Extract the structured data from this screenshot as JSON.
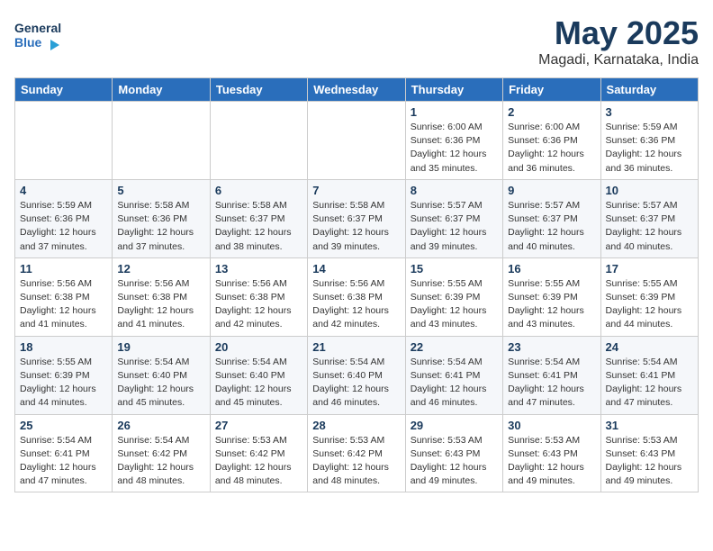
{
  "logo": {
    "line1": "General",
    "line2": "Blue"
  },
  "header": {
    "month_year": "May 2025",
    "location": "Magadi, Karnataka, India"
  },
  "weekdays": [
    "Sunday",
    "Monday",
    "Tuesday",
    "Wednesday",
    "Thursday",
    "Friday",
    "Saturday"
  ],
  "weeks": [
    [
      {
        "day": "",
        "detail": ""
      },
      {
        "day": "",
        "detail": ""
      },
      {
        "day": "",
        "detail": ""
      },
      {
        "day": "",
        "detail": ""
      },
      {
        "day": "1",
        "detail": "Sunrise: 6:00 AM\nSunset: 6:36 PM\nDaylight: 12 hours\nand 35 minutes."
      },
      {
        "day": "2",
        "detail": "Sunrise: 6:00 AM\nSunset: 6:36 PM\nDaylight: 12 hours\nand 36 minutes."
      },
      {
        "day": "3",
        "detail": "Sunrise: 5:59 AM\nSunset: 6:36 PM\nDaylight: 12 hours\nand 36 minutes."
      }
    ],
    [
      {
        "day": "4",
        "detail": "Sunrise: 5:59 AM\nSunset: 6:36 PM\nDaylight: 12 hours\nand 37 minutes."
      },
      {
        "day": "5",
        "detail": "Sunrise: 5:58 AM\nSunset: 6:36 PM\nDaylight: 12 hours\nand 37 minutes."
      },
      {
        "day": "6",
        "detail": "Sunrise: 5:58 AM\nSunset: 6:37 PM\nDaylight: 12 hours\nand 38 minutes."
      },
      {
        "day": "7",
        "detail": "Sunrise: 5:58 AM\nSunset: 6:37 PM\nDaylight: 12 hours\nand 39 minutes."
      },
      {
        "day": "8",
        "detail": "Sunrise: 5:57 AM\nSunset: 6:37 PM\nDaylight: 12 hours\nand 39 minutes."
      },
      {
        "day": "9",
        "detail": "Sunrise: 5:57 AM\nSunset: 6:37 PM\nDaylight: 12 hours\nand 40 minutes."
      },
      {
        "day": "10",
        "detail": "Sunrise: 5:57 AM\nSunset: 6:37 PM\nDaylight: 12 hours\nand 40 minutes."
      }
    ],
    [
      {
        "day": "11",
        "detail": "Sunrise: 5:56 AM\nSunset: 6:38 PM\nDaylight: 12 hours\nand 41 minutes."
      },
      {
        "day": "12",
        "detail": "Sunrise: 5:56 AM\nSunset: 6:38 PM\nDaylight: 12 hours\nand 41 minutes."
      },
      {
        "day": "13",
        "detail": "Sunrise: 5:56 AM\nSunset: 6:38 PM\nDaylight: 12 hours\nand 42 minutes."
      },
      {
        "day": "14",
        "detail": "Sunrise: 5:56 AM\nSunset: 6:38 PM\nDaylight: 12 hours\nand 42 minutes."
      },
      {
        "day": "15",
        "detail": "Sunrise: 5:55 AM\nSunset: 6:39 PM\nDaylight: 12 hours\nand 43 minutes."
      },
      {
        "day": "16",
        "detail": "Sunrise: 5:55 AM\nSunset: 6:39 PM\nDaylight: 12 hours\nand 43 minutes."
      },
      {
        "day": "17",
        "detail": "Sunrise: 5:55 AM\nSunset: 6:39 PM\nDaylight: 12 hours\nand 44 minutes."
      }
    ],
    [
      {
        "day": "18",
        "detail": "Sunrise: 5:55 AM\nSunset: 6:39 PM\nDaylight: 12 hours\nand 44 minutes."
      },
      {
        "day": "19",
        "detail": "Sunrise: 5:54 AM\nSunset: 6:40 PM\nDaylight: 12 hours\nand 45 minutes."
      },
      {
        "day": "20",
        "detail": "Sunrise: 5:54 AM\nSunset: 6:40 PM\nDaylight: 12 hours\nand 45 minutes."
      },
      {
        "day": "21",
        "detail": "Sunrise: 5:54 AM\nSunset: 6:40 PM\nDaylight: 12 hours\nand 46 minutes."
      },
      {
        "day": "22",
        "detail": "Sunrise: 5:54 AM\nSunset: 6:41 PM\nDaylight: 12 hours\nand 46 minutes."
      },
      {
        "day": "23",
        "detail": "Sunrise: 5:54 AM\nSunset: 6:41 PM\nDaylight: 12 hours\nand 47 minutes."
      },
      {
        "day": "24",
        "detail": "Sunrise: 5:54 AM\nSunset: 6:41 PM\nDaylight: 12 hours\nand 47 minutes."
      }
    ],
    [
      {
        "day": "25",
        "detail": "Sunrise: 5:54 AM\nSunset: 6:41 PM\nDaylight: 12 hours\nand 47 minutes."
      },
      {
        "day": "26",
        "detail": "Sunrise: 5:54 AM\nSunset: 6:42 PM\nDaylight: 12 hours\nand 48 minutes."
      },
      {
        "day": "27",
        "detail": "Sunrise: 5:53 AM\nSunset: 6:42 PM\nDaylight: 12 hours\nand 48 minutes."
      },
      {
        "day": "28",
        "detail": "Sunrise: 5:53 AM\nSunset: 6:42 PM\nDaylight: 12 hours\nand 48 minutes."
      },
      {
        "day": "29",
        "detail": "Sunrise: 5:53 AM\nSunset: 6:43 PM\nDaylight: 12 hours\nand 49 minutes."
      },
      {
        "day": "30",
        "detail": "Sunrise: 5:53 AM\nSunset: 6:43 PM\nDaylight: 12 hours\nand 49 minutes."
      },
      {
        "day": "31",
        "detail": "Sunrise: 5:53 AM\nSunset: 6:43 PM\nDaylight: 12 hours\nand 49 minutes."
      }
    ]
  ]
}
